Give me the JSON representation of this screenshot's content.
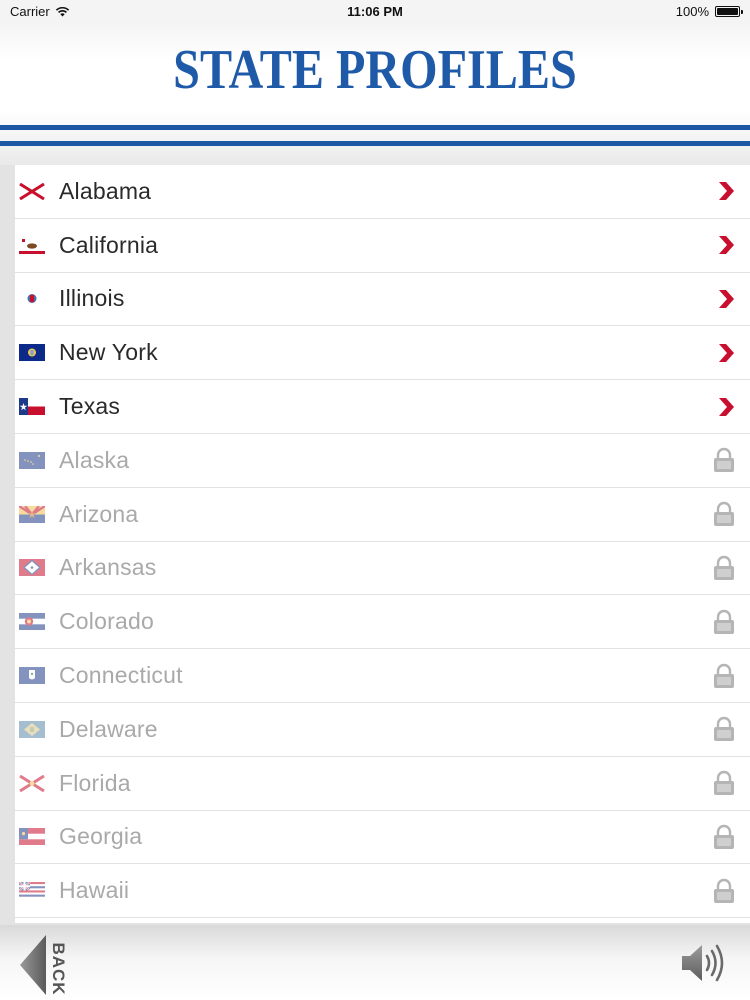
{
  "status": {
    "carrier": "Carrier",
    "time": "11:06 PM",
    "battery": "100%",
    "battery_level": 1.0
  },
  "header": {
    "title": "STATE PROFILES",
    "accent": "#1f5aa8"
  },
  "states": [
    {
      "name": "Alabama",
      "flag": "alabama-flag",
      "locked": false
    },
    {
      "name": "California",
      "flag": "california-flag",
      "locked": false
    },
    {
      "name": "Illinois",
      "flag": "illinois-flag",
      "locked": false
    },
    {
      "name": "New York",
      "flag": "new-york-flag",
      "locked": false
    },
    {
      "name": "Texas",
      "flag": "texas-flag",
      "locked": false
    },
    {
      "name": "Alaska",
      "flag": "alaska-flag",
      "locked": true
    },
    {
      "name": "Arizona",
      "flag": "arizona-flag",
      "locked": true
    },
    {
      "name": "Arkansas",
      "flag": "arkansas-flag",
      "locked": true
    },
    {
      "name": "Colorado",
      "flag": "colorado-flag",
      "locked": true
    },
    {
      "name": "Connecticut",
      "flag": "connecticut-flag",
      "locked": true
    },
    {
      "name": "Delaware",
      "flag": "delaware-flag",
      "locked": true
    },
    {
      "name": "Florida",
      "flag": "florida-flag",
      "locked": true
    },
    {
      "name": "Georgia",
      "flag": "georgia-flag",
      "locked": true
    },
    {
      "name": "Hawaii",
      "flag": "hawaii-flag",
      "locked": true
    }
  ],
  "icons": {
    "unlocked": "chevron-right-icon",
    "locked": "lock-icon",
    "back": "back-arrow-icon",
    "sound": "speaker-icon"
  },
  "colors": {
    "chevron": "#c8102e",
    "lock": "#b5b5b5"
  },
  "footer": {
    "back_label": "BACK"
  }
}
